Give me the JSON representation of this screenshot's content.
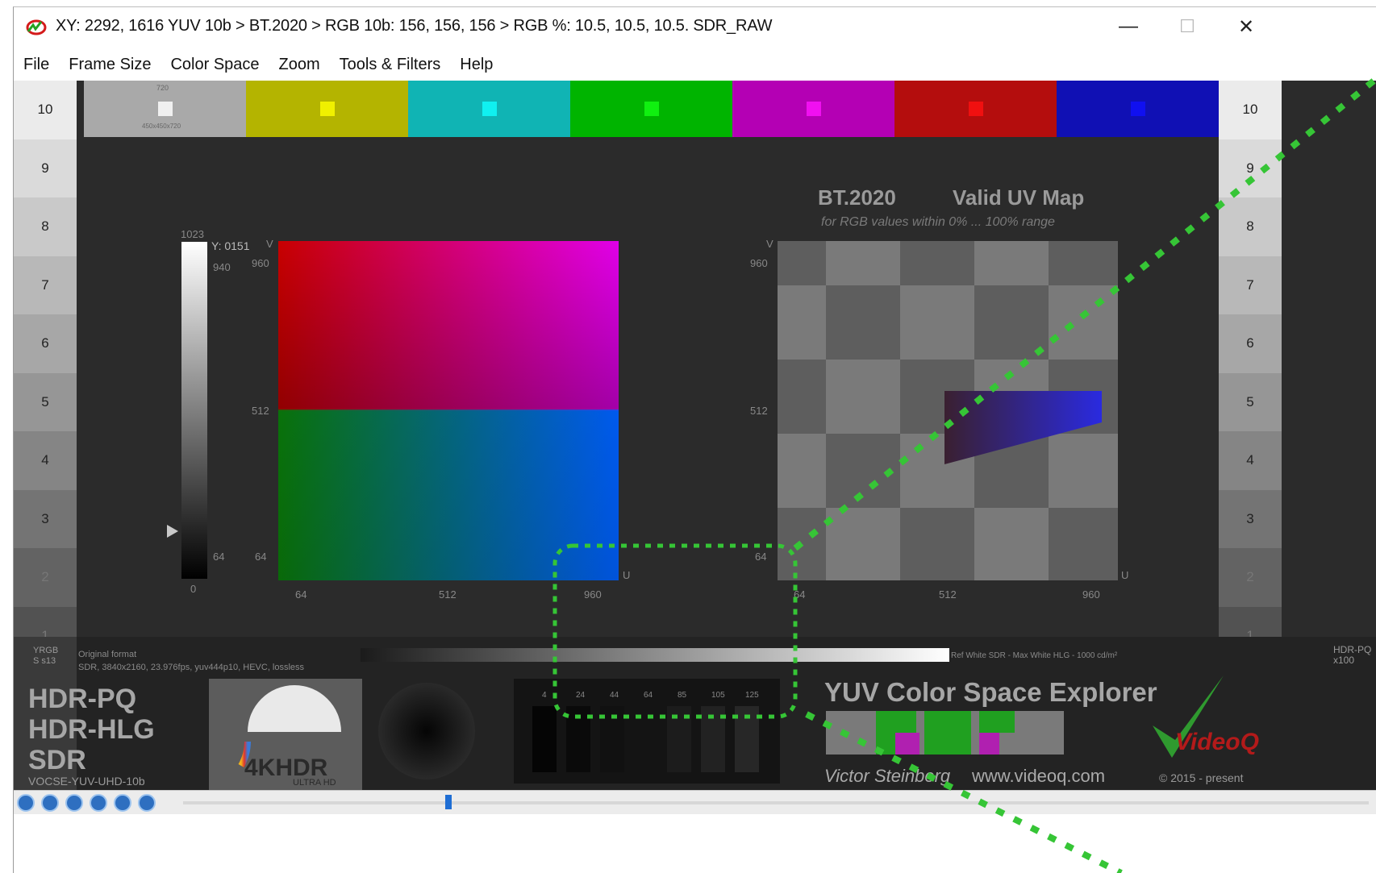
{
  "titlebar": {
    "title": "XY:  2292, 1616  YUV 10b > BT.2020 > RGB 10b:  156, 156, 156 > RGB %:  10.5, 10.5, 10.5. SDR_RAW",
    "minimize": "—",
    "maximize": "☐",
    "close": "✕"
  },
  "menu": [
    "File",
    "Frame Size",
    "Color Space",
    "Zoom",
    "Tools & Filters",
    "Help"
  ],
  "colors": {
    "bars": [
      "#a9a9a9",
      "#b4b400",
      "#10b4b4",
      "#00b400",
      "#b400b4",
      "#b40d0d",
      "#1010b4"
    ],
    "squares": [
      "#f0f0f0",
      "#f0f000",
      "#10f0f0",
      "#10f010",
      "#f010f0",
      "#f01010",
      "#1010f0"
    ],
    "overlay_dots": "#36c536",
    "background": "#2b2b2b"
  },
  "white_bar": {
    "top": "720",
    "bottom": "450x450x720"
  },
  "scale_left": [
    "10",
    "9",
    "8",
    "7",
    "6",
    "5",
    "4",
    "3",
    "2",
    "1"
  ],
  "scale_right": [
    "10",
    "9",
    "8",
    "7",
    "6",
    "5",
    "4",
    "3",
    "2",
    "1"
  ],
  "luma": {
    "top_label": "1023",
    "bottom_label": "0",
    "value_readout": "Y: 0151",
    "v_label": "V",
    "tick_940": "940",
    "tick_64": "64"
  },
  "uv_square": {
    "ticks_v": [
      "960",
      "512",
      "64"
    ],
    "ticks_u": [
      "64",
      "512",
      "960"
    ],
    "u_label": "U"
  },
  "uv_map": {
    "title": "BT.2020",
    "title2": "Valid UV Map",
    "subtitle": "for RGB values within 0% ... 100% range",
    "v_label": "V",
    "u_label": "U",
    "ticks_v": [
      "960",
      "512",
      "64"
    ],
    "ticks_u": [
      "64",
      "512",
      "960"
    ]
  },
  "info_row": {
    "left_tag_1": "YRGB",
    "left_tag_2": "S s13",
    "original_format": "Original format",
    "format_details": "SDR, 3840x2160, 23.976fps, yuv444p10, HEVC, lossless",
    "ref_white_sdr": "Ref White SDR - Max White HLG - 1000 cd/m²",
    "right_tag_1": "HDR-PQ",
    "right_tag_2": "x100"
  },
  "hdr_labels": [
    "HDR-PQ",
    "HDR-HLG",
    "SDR"
  ],
  "pattern_code": "VOCSE-YUV-UHD-10b",
  "logo": {
    "main": "4KHDR",
    "sub": "ULTRA HD"
  },
  "explorer": {
    "title": "YUV Color Space Explorer",
    "signature": "Victor Steinberg",
    "url": "www.videoq.com",
    "copyright": "© 2015 - present",
    "brand": "VideoQ"
  },
  "ramp_ticks": [
    "4",
    "24",
    "44",
    "64",
    "85",
    "105",
    "125"
  ]
}
